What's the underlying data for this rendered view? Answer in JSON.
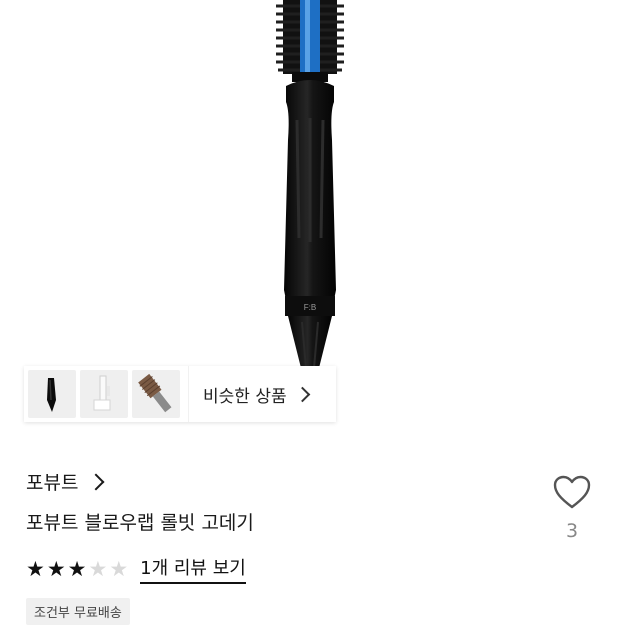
{
  "hero": {
    "image_label": "F:B",
    "colors": {
      "handle": "#0b0b0b",
      "bristles": "#1e6fc4"
    }
  },
  "thumbnails": [
    {
      "icon": "black-styler-thumbnail-icon"
    },
    {
      "icon": "white-styler-thumbnail-icon"
    },
    {
      "icon": "round-brush-thumbnail-icon"
    }
  ],
  "similar_products": {
    "label": "비슷한 상품"
  },
  "product": {
    "brand": "포뷰트",
    "name": "포뷰트 블로우랩 롤빗 고데기",
    "like_count": "3",
    "rating": {
      "score": 3,
      "max": 5
    },
    "review_link": "1개 리뷰 보기",
    "shipping_badge": "조건부 무료배송"
  }
}
